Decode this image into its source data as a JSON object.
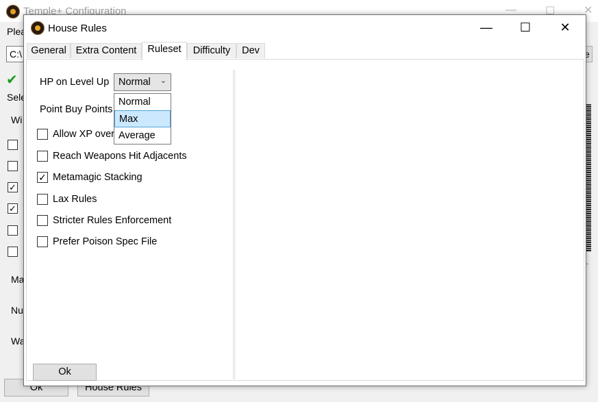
{
  "background_window": {
    "title": "Temple+ Configuration",
    "fragments": {
      "please": "Plea",
      "path": "C:\\",
      "select": "Sele",
      "wi": "Wi",
      "ma": "Ma",
      "nu": "Nu",
      "wa": "Wa",
      "right_edge": "e"
    },
    "checkboxes": [
      false,
      false,
      true,
      true,
      false,
      false
    ],
    "ok_label": "Ok",
    "house_rules_label": "House Rules"
  },
  "dialog": {
    "title": "House Rules",
    "controls": {
      "minimize": "—",
      "maximize": "☐",
      "close": "✕"
    },
    "tabs": [
      {
        "label": "General",
        "active": false
      },
      {
        "label": "Extra Content",
        "active": false
      },
      {
        "label": "Ruleset",
        "active": true
      },
      {
        "label": "Difficulty",
        "active": false
      },
      {
        "label": "Dev",
        "active": false
      }
    ],
    "ruleset": {
      "hp_label": "HP on Level Up",
      "hp_value": "Normal",
      "hp_options": [
        "Normal",
        "Max",
        "Average"
      ],
      "hp_highlighted": "Max",
      "point_buy_label": "Point Buy Points",
      "checkboxes": [
        {
          "label": "Allow XP overflow",
          "visible_label": "Allow XP over",
          "checked": false
        },
        {
          "label": "Reach Weapons Hit Adjacents",
          "checked": false
        },
        {
          "label": "Metamagic Stacking",
          "checked": true
        },
        {
          "label": "Lax Rules",
          "checked": false
        },
        {
          "label": "Stricter Rules Enforcement",
          "checked": false
        },
        {
          "label": "Prefer Poison Spec File",
          "checked": false
        }
      ]
    },
    "ok_label": "Ok"
  }
}
